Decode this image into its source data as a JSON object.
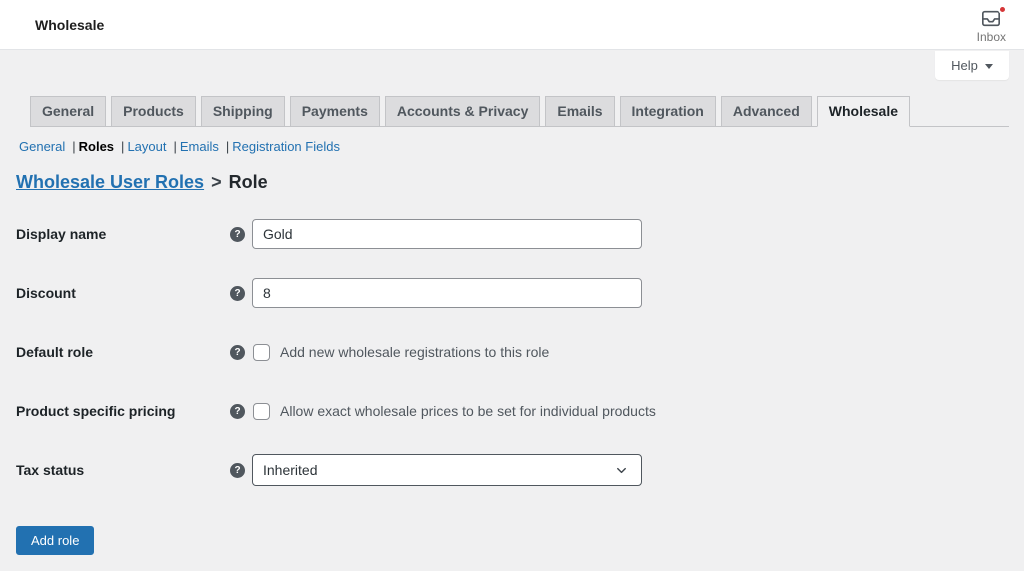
{
  "header": {
    "title": "Wholesale",
    "inbox_label": "Inbox"
  },
  "help": {
    "label": "Help"
  },
  "tabs": {
    "items": [
      {
        "label": "General",
        "active": false
      },
      {
        "label": "Products",
        "active": false
      },
      {
        "label": "Shipping",
        "active": false
      },
      {
        "label": "Payments",
        "active": false
      },
      {
        "label": "Accounts & Privacy",
        "active": false
      },
      {
        "label": "Emails",
        "active": false
      },
      {
        "label": "Integration",
        "active": false
      },
      {
        "label": "Advanced",
        "active": false
      },
      {
        "label": "Wholesale",
        "active": true
      }
    ]
  },
  "subnav": {
    "separator": "|",
    "items": [
      {
        "label": "General",
        "current": false
      },
      {
        "label": "Roles",
        "current": true
      },
      {
        "label": "Layout",
        "current": false
      },
      {
        "label": "Emails",
        "current": false
      },
      {
        "label": "Registration Fields",
        "current": false
      }
    ]
  },
  "breadcrumb": {
    "link": "Wholesale User Roles",
    "separator": ">",
    "current": "Role"
  },
  "form": {
    "rows": [
      {
        "label": "Display name",
        "type": "text",
        "value": "Gold"
      },
      {
        "label": "Discount",
        "type": "text",
        "value": "8"
      },
      {
        "label": "Default role",
        "type": "checkbox",
        "checked": false,
        "text": "Add new wholesale registrations to this role"
      },
      {
        "label": "Product specific pricing",
        "type": "checkbox",
        "checked": false,
        "text": "Allow exact wholesale prices to be set for individual products"
      },
      {
        "label": "Tax status",
        "type": "select",
        "value": "Inherited"
      }
    ],
    "submit_label": "Add role"
  },
  "colors": {
    "accent": "#2271b1",
    "notification_dot": "#d63638",
    "page_background": "#f0f0f1",
    "tab_inactive": "#dcdcde",
    "tab_border": "#c3c4c7"
  }
}
